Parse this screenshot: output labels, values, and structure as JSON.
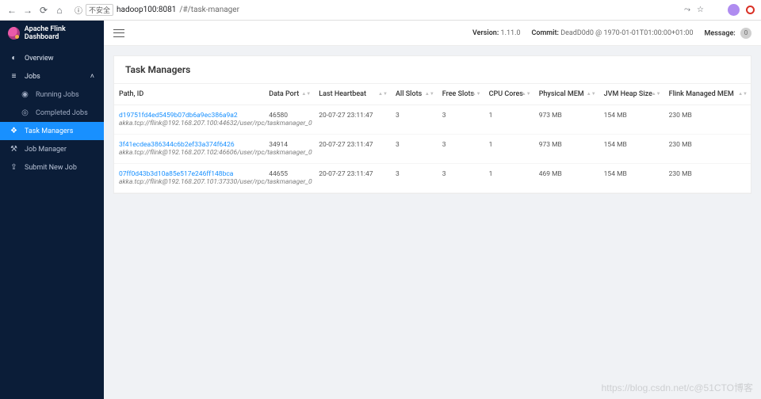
{
  "chrome": {
    "insecure": "不安全",
    "host": "hadoop100:8081",
    "path": "/#/task-manager",
    "colors": {
      "ext1": "#b148c8",
      "prof": "#af8cf0",
      "stop": "#d93025"
    }
  },
  "brand": "Apache Flink Dashboard",
  "sidebar": {
    "overview": "Overview",
    "jobs": "Jobs",
    "running": "Running Jobs",
    "completed": "Completed Jobs",
    "tm": "Task Managers",
    "jm": "Job Manager",
    "submit": "Submit New Job"
  },
  "topbar": {
    "versionLabel": "Version:",
    "version": "1.11.0",
    "commitLabel": "Commit:",
    "commit": "DeadD0d0 @ 1970-01-01T01:00:00+01:00",
    "messageLabel": "Message:",
    "msgCount": "0"
  },
  "card": {
    "title": "Task Managers"
  },
  "columns": {
    "path": "Path, ID",
    "port": "Data Port",
    "hb": "Last Heartbeat",
    "as": "All Slots",
    "fs": "Free Slots",
    "cc": "CPU Cores",
    "pm": "Physical MEM",
    "jh": "JVM Heap Size",
    "fm": "Flink Managed MEM"
  },
  "rows": [
    {
      "id": "d19751fd4ed5459b07db6a9ec386a9a2",
      "akka": "akka.tcp://flink@192.168.207.100:44632/user/rpc/taskmanager_0",
      "port": "46580",
      "hb": "20-07-27 23:11:47",
      "as": "3",
      "fs": "3",
      "cc": "1",
      "pm": "973 MB",
      "jh": "154 MB",
      "fm": "230 MB"
    },
    {
      "id": "3f41ecdea386344c6b2ef33a374f6426",
      "akka": "akka.tcp://flink@192.168.207.102:46606/user/rpc/taskmanager_0",
      "port": "34914",
      "hb": "20-07-27 23:11:47",
      "as": "3",
      "fs": "3",
      "cc": "1",
      "pm": "973 MB",
      "jh": "154 MB",
      "fm": "230 MB"
    },
    {
      "id": "07ff0d43b3d10a85e517e246ff148bca",
      "akka": "akka.tcp://flink@192.168.207.101:37330/user/rpc/taskmanager_0",
      "port": "44655",
      "hb": "20-07-27 23:11:47",
      "as": "3",
      "fs": "3",
      "cc": "1",
      "pm": "469 MB",
      "jh": "154 MB",
      "fm": "230 MB"
    }
  ],
  "watermark": "https://blog.csdn.net/c@51CTO博客"
}
